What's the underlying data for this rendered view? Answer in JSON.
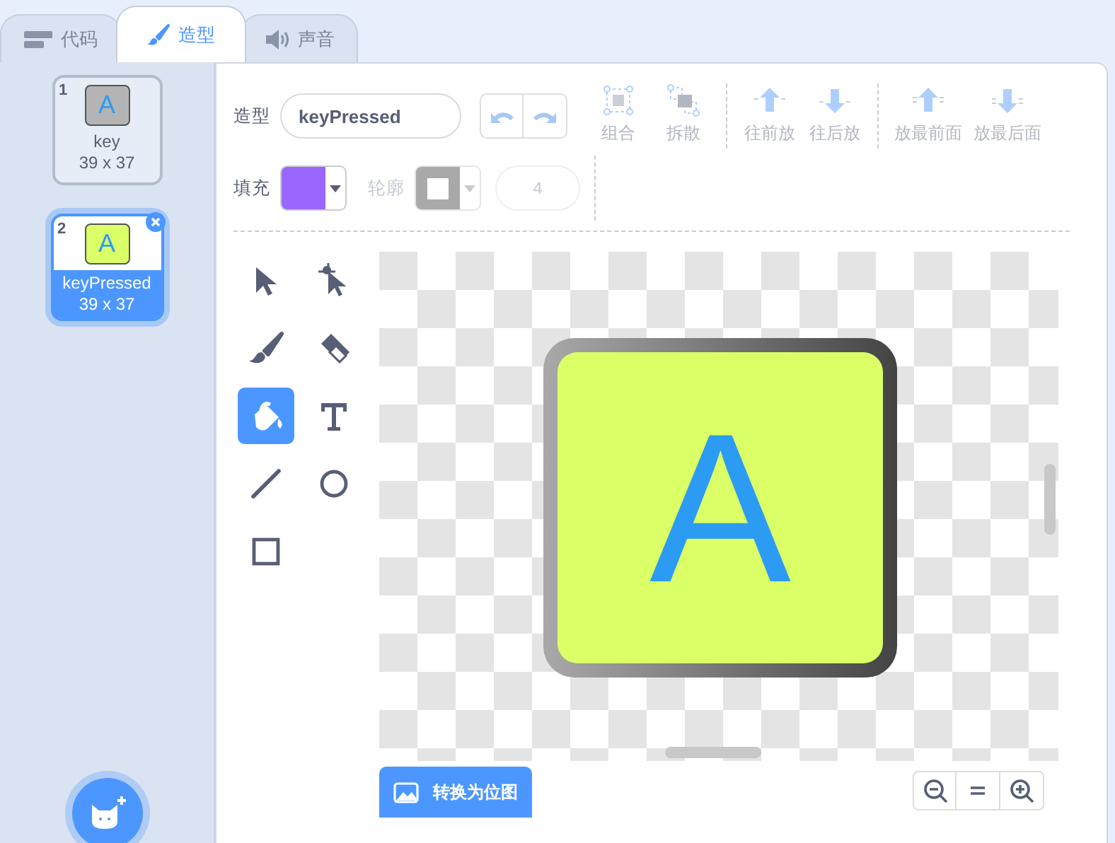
{
  "tabs": [
    {
      "kind": "code",
      "label": "代码",
      "selected": false
    },
    {
      "kind": "costume",
      "label": "造型",
      "selected": true
    },
    {
      "kind": "sound",
      "label": "声音",
      "selected": false
    }
  ],
  "costumes": [
    {
      "number": "1",
      "thumbnail_letter": "A",
      "color": "#b4b4b4",
      "name": "key",
      "size": "39 x 37",
      "selected": false
    },
    {
      "number": "2",
      "thumbnail_letter": "A",
      "color": "#dbff66",
      "name": "keyPressed",
      "size": "39 x 37",
      "selected": true
    }
  ],
  "editor": {
    "costume_label": "造型",
    "costume_name": "keyPressed",
    "history": [
      {
        "kind": "undo",
        "disabled": true
      },
      {
        "kind": "redo",
        "disabled": true
      }
    ],
    "arrange_groups": [
      [
        {
          "kind": "group",
          "label": "组合",
          "disabled": true
        },
        {
          "kind": "ungroup",
          "label": "拆散",
          "disabled": true
        }
      ],
      [
        {
          "kind": "forward",
          "label": "往前放",
          "disabled": true
        },
        {
          "kind": "backward",
          "label": "往后放",
          "disabled": true
        }
      ],
      [
        {
          "kind": "front",
          "label": "放最前面",
          "disabled": true
        },
        {
          "kind": "back",
          "label": "放最后面",
          "disabled": true
        }
      ]
    ],
    "fill": {
      "label": "填充",
      "color": "#9966ff"
    },
    "outline": {
      "label": "轮廓",
      "disabled": true
    },
    "outline_width": {
      "value": "4",
      "disabled": true
    },
    "tools": [
      {
        "kind": "select",
        "selected": false
      },
      {
        "kind": "reshape",
        "selected": false
      },
      {
        "kind": "brush",
        "selected": false
      },
      {
        "kind": "eraser",
        "selected": false
      },
      {
        "kind": "fill",
        "selected": true
      },
      {
        "kind": "text",
        "selected": false
      },
      {
        "kind": "line",
        "selected": false
      },
      {
        "kind": "circle",
        "selected": false
      },
      {
        "kind": "rect",
        "selected": false
      }
    ],
    "canvas": {
      "artwork_letter": "A"
    },
    "convert_button": "转换为位图",
    "zoom": [
      {
        "kind": "zoom-out"
      },
      {
        "kind": "reset"
      },
      {
        "kind": "zoom-in"
      }
    ]
  }
}
